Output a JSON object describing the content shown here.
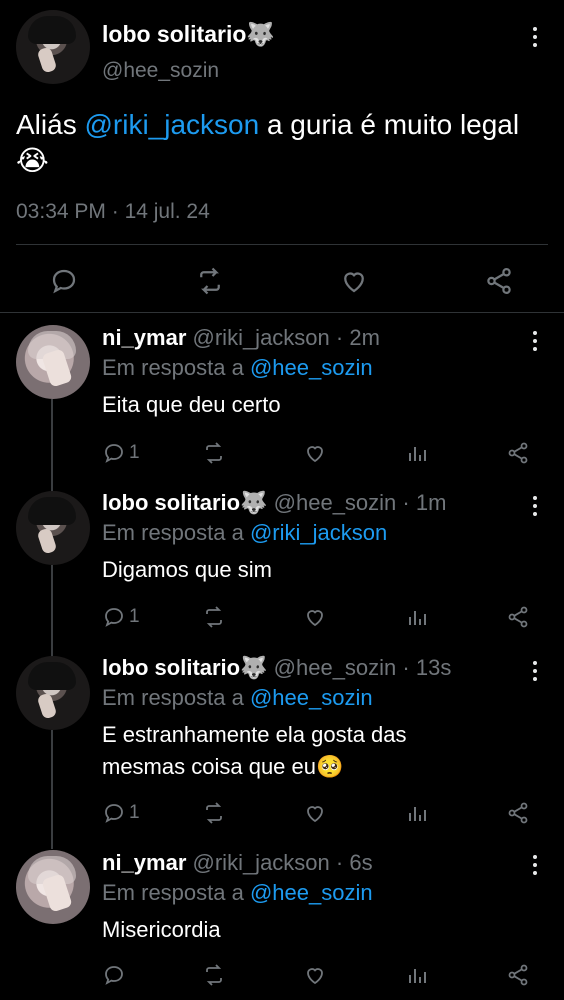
{
  "main_tweet": {
    "name": "lobo solitario",
    "name_emoji": "🐺",
    "handle": "@hee_sozin",
    "text_before": "Aliás ",
    "mention": "@riki_jackson",
    "text_after": " a guria é muito legal",
    "text_emoji": "😭",
    "time": "03:34 PM",
    "date": "14 jul. 24"
  },
  "replies": [
    {
      "name": "ni_ymar",
      "name_emoji": "",
      "handle": "@riki_jackson",
      "time": "2m",
      "reply_prefix": "Em resposta a",
      "reply_to": "@hee_sozin",
      "text": "Eita que deu certo",
      "text_emoji": "",
      "reply_count": "1"
    },
    {
      "name": "lobo solitario",
      "name_emoji": "🐺",
      "handle": "@hee_sozin",
      "time": "1m",
      "reply_prefix": "Em resposta a",
      "reply_to": "@riki_jackson",
      "text": "Digamos que sim",
      "text_emoji": "",
      "reply_count": "1"
    },
    {
      "name": "lobo solitario",
      "name_emoji": "🐺",
      "handle": "@hee_sozin",
      "time": "13s",
      "reply_prefix": "Em resposta a",
      "reply_to": "@hee_sozin",
      "text": "E estranhamente ela gosta das mesmas coisa que eu",
      "text_emoji": "🥺",
      "reply_count": "1"
    },
    {
      "name": "ni_ymar",
      "name_emoji": "",
      "handle": "@riki_jackson",
      "time": "6s",
      "reply_prefix": "Em resposta a",
      "reply_to": "@hee_sozin",
      "text": "Misericordia",
      "text_emoji": "",
      "reply_count": ""
    }
  ],
  "icons": {
    "reply": "comment-icon",
    "retweet": "retweet-icon",
    "like": "heart-icon",
    "share": "share-icon",
    "analytics": "analytics-icon",
    "more": "more-vertical-icon"
  },
  "colors": {
    "background": "#000000",
    "text": "#e7e9ea",
    "muted": "#71767b",
    "link": "#1d9bf0",
    "divider": "#2f3336"
  }
}
